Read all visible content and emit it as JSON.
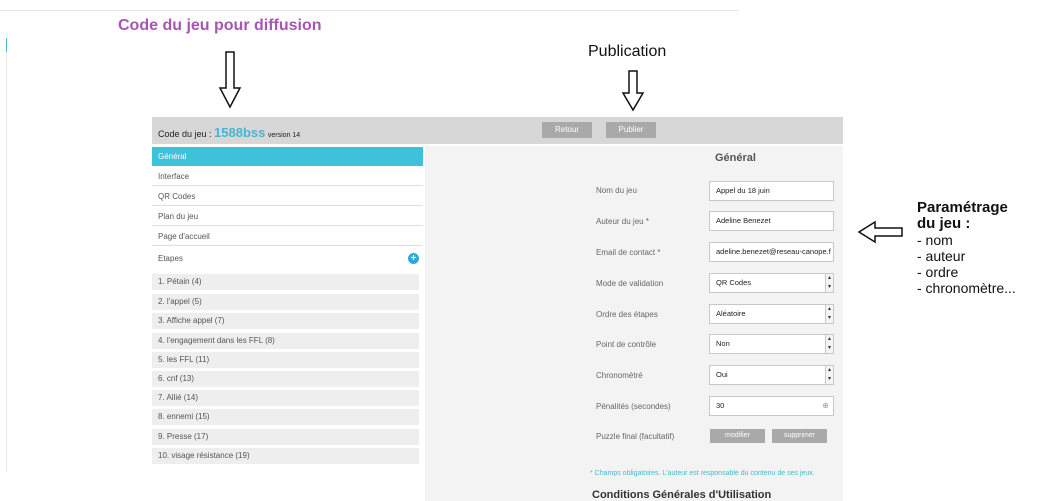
{
  "annotations": {
    "code_title": "Code du jeu pour diffusion",
    "publication": "Publication",
    "parametrage_title_1": "Paramétrage",
    "parametrage_title_2": "du jeu :",
    "items": [
      "- nom",
      "- auteur",
      "- ordre",
      "- chronomètre..."
    ]
  },
  "arrows": [
    "down-arrow",
    "down-arrow",
    "left-arrow"
  ],
  "header": {
    "code_label": "Code du jeu : ",
    "code_value": "1588bss",
    "version": "version 14",
    "retour_label": "Retour",
    "publier_label": "Publier"
  },
  "sidebar": {
    "items": [
      "Général",
      "Interface",
      "QR Codes",
      "Plan du jeu",
      "Page d'accueil",
      "Etapes"
    ],
    "steps": [
      "1. Pétain (4)",
      "2. l'appel (5)",
      "3. Affiche appel (7)",
      "4. l'engagement dans les FFL (8)",
      "5. les FFL (11)",
      "6. cnf (13)",
      "7. Allié (14)",
      "8. ennemi (15)",
      "9. Presse (17)",
      "10. visage résistance (19)"
    ]
  },
  "main": {
    "title": "Général",
    "fields": {
      "nom": {
        "label": "Nom du jeu",
        "value": "Appel du 18 juin"
      },
      "auteur": {
        "label": "Auteur du jeu *",
        "value": "Adeline Benezet"
      },
      "email": {
        "label": "Email de contact *",
        "value": "adeline.benezet@reseau-canope.f"
      },
      "mode": {
        "label": "Mode de validation",
        "value": "QR Codes"
      },
      "ordre": {
        "label": "Ordre des étapes",
        "value": "Aléatoire"
      },
      "controle": {
        "label": "Point de contrôle",
        "value": "Non"
      },
      "chrono": {
        "label": "Chronométré",
        "value": "Oui"
      },
      "penalites": {
        "label": "Pénalités (secondes)",
        "value": "30"
      },
      "puzzle": {
        "label": "Puzzle final (facultatif)"
      }
    },
    "modifier_label": "modifier",
    "supprimer_label": "supprimer",
    "note": "* Champs obligatoires. L'auteur est responsable du contenu de ses jeux.",
    "cgu_title": "Conditions Générales d'Utilisation"
  },
  "colors": {
    "accent": "#3ec2dc",
    "annotation_title": "#a855b4"
  }
}
